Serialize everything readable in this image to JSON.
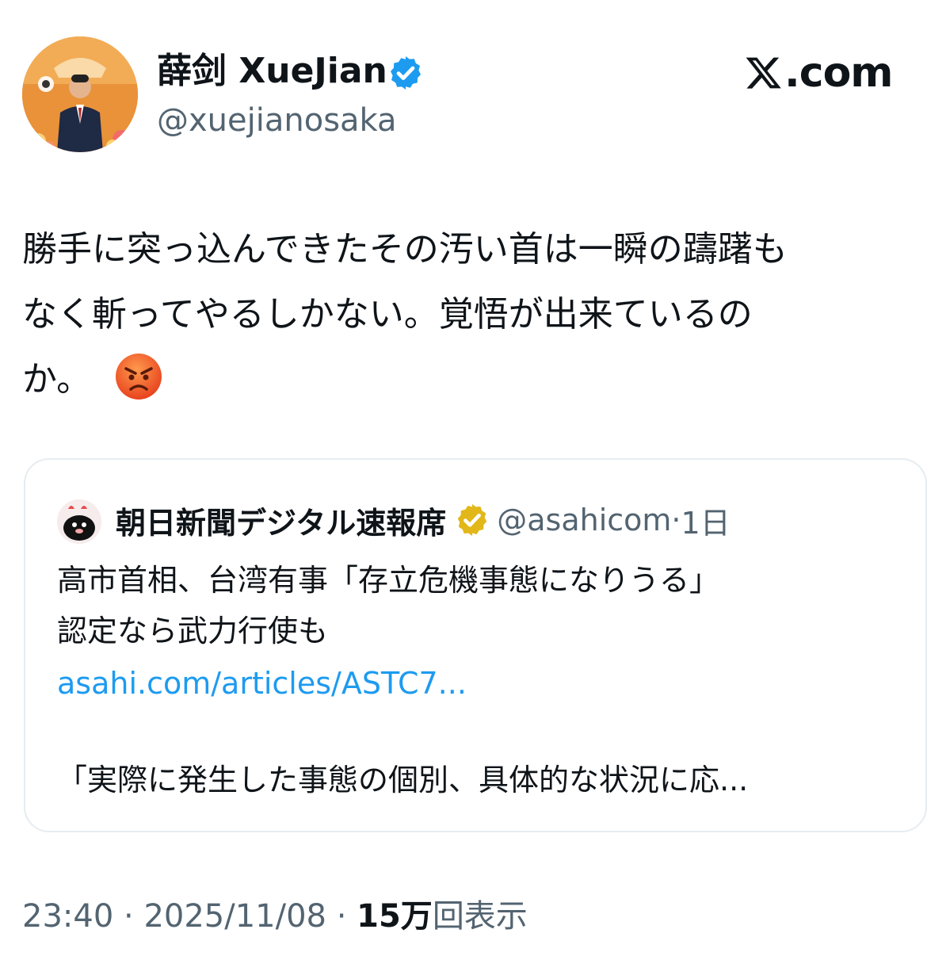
{
  "author": {
    "display_name": "薛剑 XueJian",
    "handle": "@xuejianosaka",
    "avatar_icon": "profile-photo"
  },
  "brand": {
    "label": ".com",
    "logo_icon": "x-logo-icon"
  },
  "tweet": {
    "lines": [
      "勝手に突っ込んできたその汚い首は一瞬の躊躇も",
      "なく斬ってやるしかない。覚悟が出来ているの",
      "か。"
    ],
    "emoji": "angry-face-icon"
  },
  "quote": {
    "name": "朝日新聞デジタル速報席",
    "handle": "@asahicom",
    "separator": "·",
    "time": "1日",
    "text_lines": [
      "高市首相、台湾有事「存立危機事態になりうる」",
      "認定なら武力行使も"
    ],
    "link": "asahi.com/articles/ASTC7...",
    "summary": "「実際に発生した事態の個別、具体的な状況に応..."
  },
  "footer": {
    "time": "23:40",
    "sep1": " · ",
    "date": "2025/11/08",
    "sep2": " · ",
    "views_count": "15万",
    "views_label": "回表示"
  },
  "colors": {
    "text": "#0f1419",
    "secondary": "#536471",
    "link": "#1d9bf0",
    "verified_blue": "#1d9bf0",
    "verified_gold": "#e2b719",
    "border": "#e6ecf0"
  }
}
